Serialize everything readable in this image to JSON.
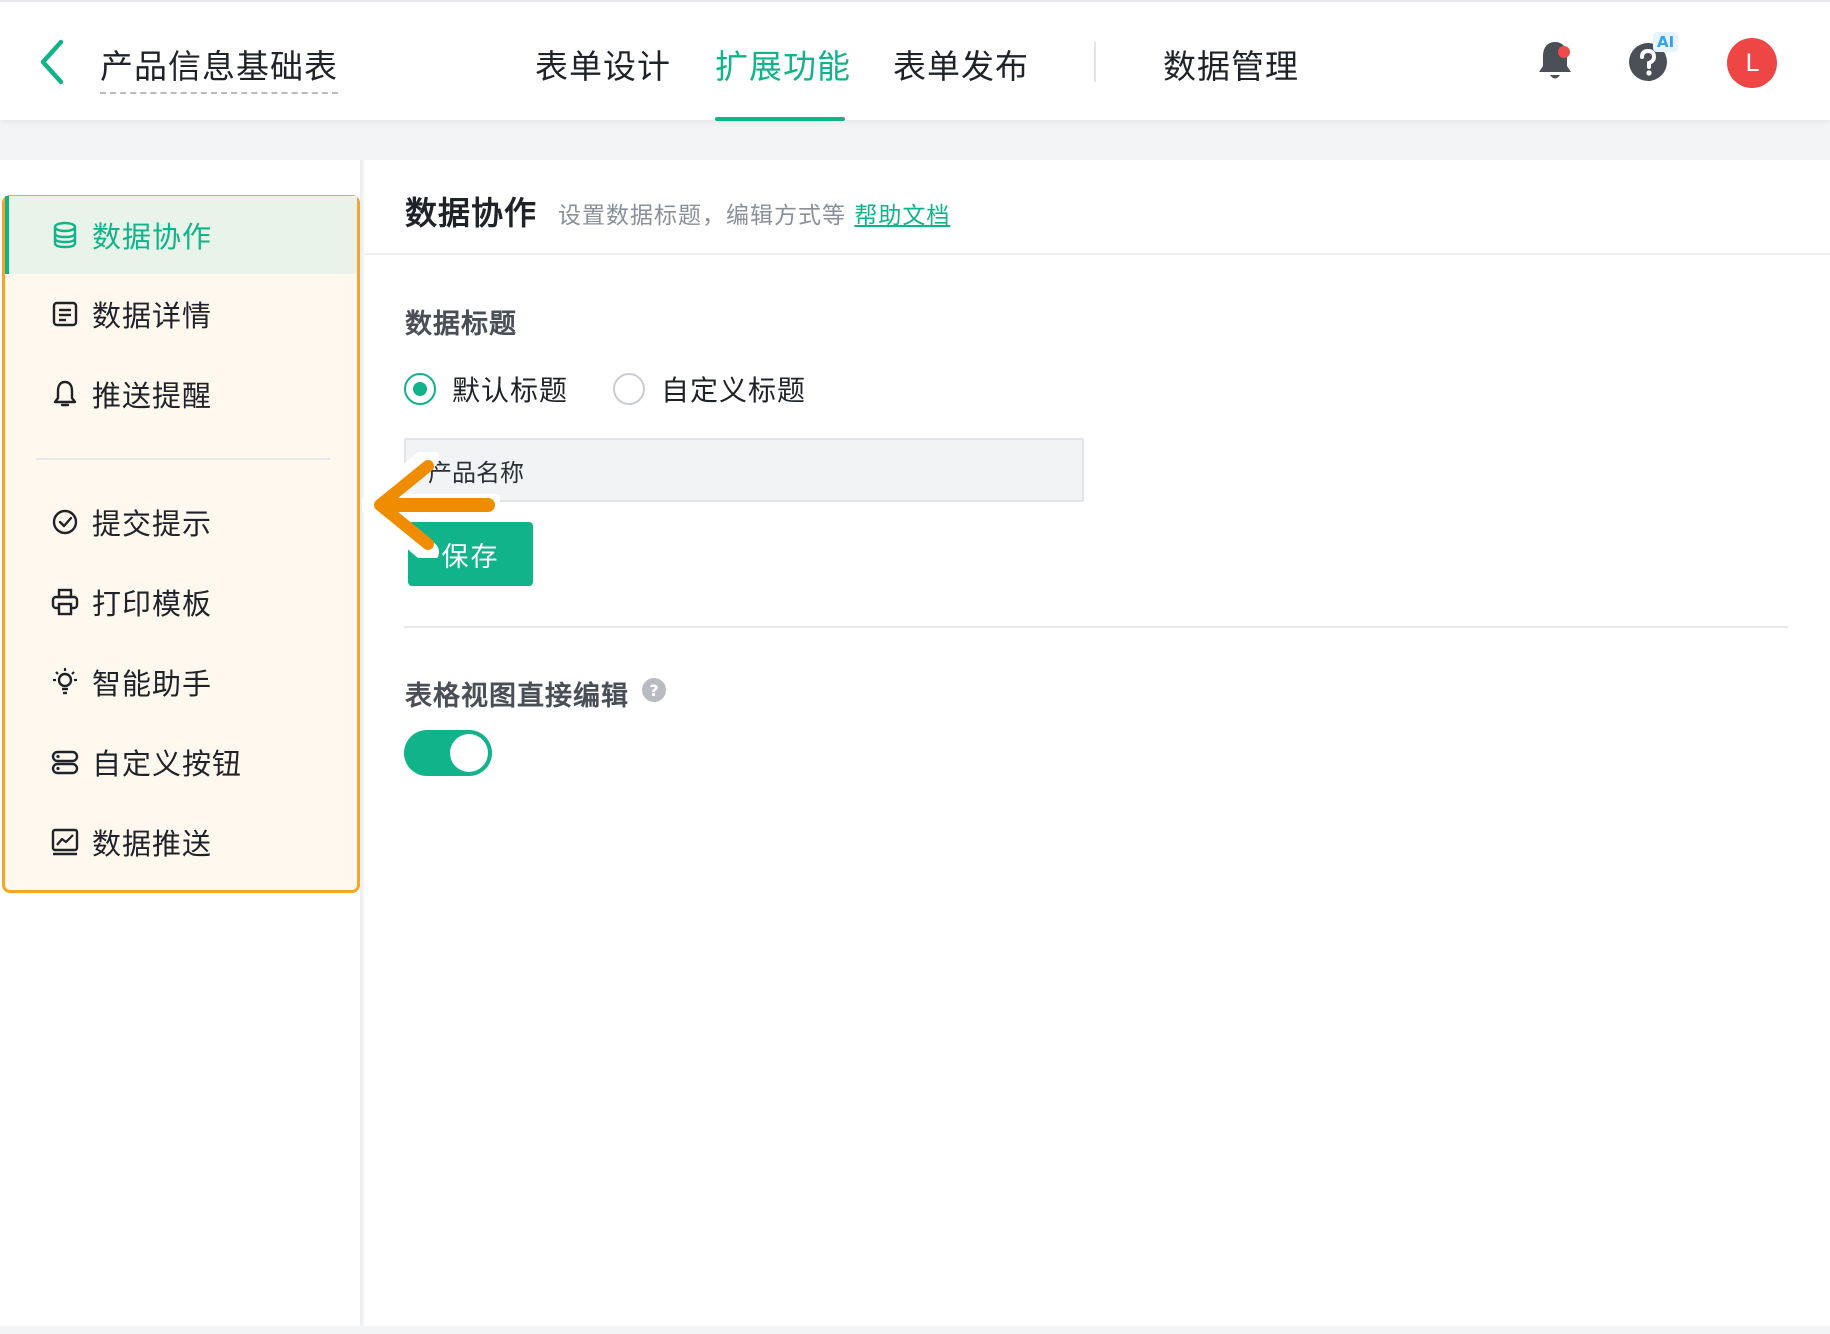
{
  "header": {
    "form_name": "产品信息基础表",
    "tabs": [
      {
        "label": "表单设计"
      },
      {
        "label": "扩展功能"
      },
      {
        "label": "表单发布"
      },
      {
        "label": "数据管理"
      }
    ],
    "ai_badge": "AI",
    "avatar_initial": "L",
    "accent_color": "#10b38a"
  },
  "sidebar": {
    "items": [
      {
        "label": "数据协作",
        "icon": "database-icon"
      },
      {
        "label": "数据详情",
        "icon": "detail-icon"
      },
      {
        "label": "推送提醒",
        "icon": "bell-icon"
      },
      {
        "label": "提交提示",
        "icon": "check-circle-icon"
      },
      {
        "label": "打印模板",
        "icon": "printer-icon"
      },
      {
        "label": "智能助手",
        "icon": "bulb-icon"
      },
      {
        "label": "自定义按钮",
        "icon": "button-icon"
      },
      {
        "label": "数据推送",
        "icon": "chart-icon"
      }
    ]
  },
  "main": {
    "title": "数据协作",
    "description": "设置数据标题，编辑方式等",
    "help_link": "帮助文档",
    "data_title_section": {
      "heading": "数据标题",
      "options": [
        {
          "label": "默认标题",
          "checked": true
        },
        {
          "label": "自定义标题",
          "checked": false
        }
      ],
      "input_value": "产品名称",
      "save_label": "保存"
    },
    "table_edit_section": {
      "heading": "表格视图直接编辑",
      "help_glyph": "?",
      "enabled": true
    }
  }
}
